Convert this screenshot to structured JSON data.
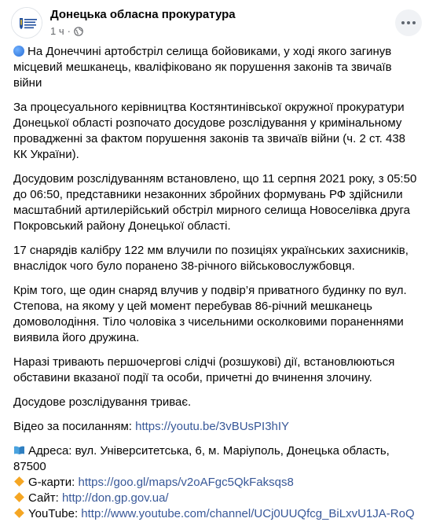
{
  "header": {
    "page_name": "Донецька обласна прокуратура",
    "time": "1 ч",
    "dot": "·"
  },
  "post": {
    "lead_text": "На Донеччині артобстріл селища бойовиками, у ході якого загинув місцевий мешканець, кваліфіковано як порушення законів та звичаїв війни",
    "paragraphs": [
      "За процесуального керівництва Костянтинівської окружної прокуратури Донецької області розпочато досудове розслідування у кримінальному провадженні за фактом порушення законів та звичаїв війни (ч. 2 ст. 438 КК України).",
      "Досудовим розслідуванням встановлено, що 11 серпня 2021 року, з 05:50 до 06:50, представники незаконних збройних формувань РФ здійснили масштабний артилерійський обстріл мирного селища Новоселівка друга Покровський району Донецької області.",
      "17 снарядів калібру 122 мм влучили по позиціях українських захисників, внаслідок чого було поранено 38-річного військовослужбовця.",
      "Крім того, ще один снаряд влучив у подвір’я приватного будинку по вул. Степова, на якому у цей момент перебував 86-річний мешканець домоволодіння. Тіло чоловіка з чисельними осколковими пораненнями виявила його дружина.",
      "Наразі тривають першочергові слідчі (розшукові) дії, встановлюються обставини вказаної події та особи, причетні до вчинення злочину.",
      "Досудове розслідування триває."
    ],
    "video_label": "Відео за посиланням: ",
    "video_url": "https://youtu.be/3vBUsPI3hIY",
    "address": "Адреса: вул. Університетська, 6, м. Маріуполь, Донецька область, 87500",
    "gmaps_label": "G-карти: ",
    "gmaps_url": "https://goo.gl/maps/v2oAFgc5QkFaksqs8",
    "site_label": "Сайт: ",
    "site_url": "http://don.gp.gov.ua/",
    "youtube_label": "YouTube: ",
    "youtube_url": "http://www.youtube.com/channel/UCj0UUQfcg_BiLxvU1JA-RoQ"
  },
  "icons": {
    "avatar": "prosecutor-emblem",
    "privacy": "globe-icon",
    "more": "more-dots-icon",
    "lead": "blue-circle-icon",
    "address": "book-icon",
    "bullet": "orange-diamond-icon"
  },
  "colors": {
    "link": "#385898",
    "secondary_text": "#65676b",
    "bullet": "#f5a623"
  }
}
